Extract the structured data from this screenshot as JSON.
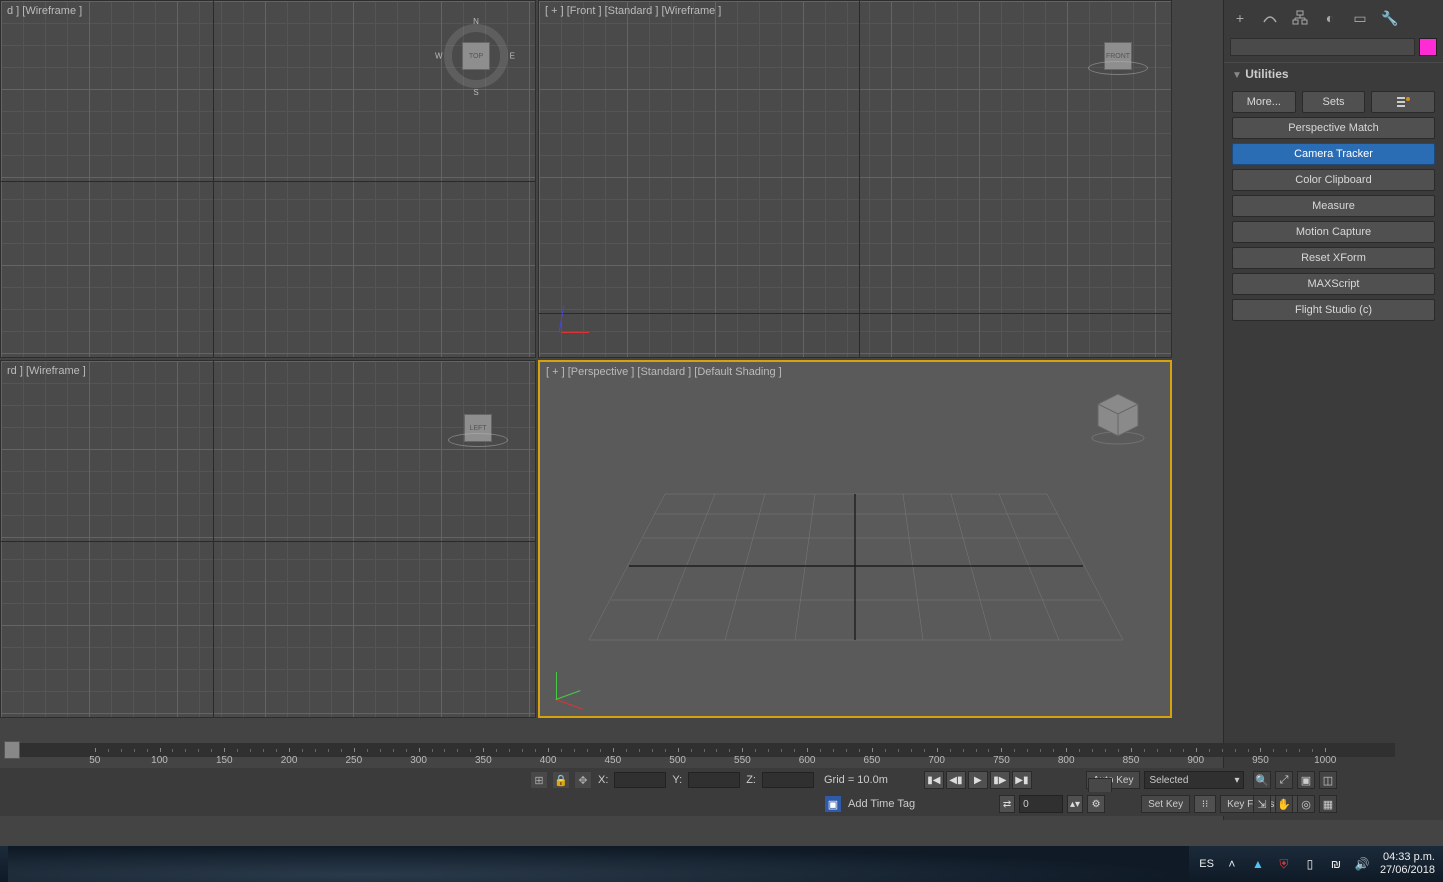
{
  "viewports": {
    "top_left": {
      "label": "d ] [Wireframe ]",
      "cube": "TOP",
      "compass": {
        "n": "N",
        "e": "E",
        "s": "S",
        "w": "W"
      }
    },
    "top_right": {
      "label": "[ + ] [Front ] [Standard ] [Wireframe ]",
      "cube": "FRONT"
    },
    "bottom_left": {
      "label": "rd ] [Wireframe ]",
      "cube": "LEFT"
    },
    "bottom_right": {
      "label": "[ + ] [Perspective ] [Standard ] [Default Shading ]"
    }
  },
  "side_panel": {
    "rollout_title": "Utilities",
    "more_label": "More...",
    "sets_label": "Sets",
    "buttons": {
      "persp_match": "Perspective Match",
      "camera_tracker": "Camera Tracker",
      "color_clipboard": "Color Clipboard",
      "measure": "Measure",
      "motion_capture": "Motion Capture",
      "reset_xform": "Reset XForm",
      "maxscript": "MAXScript",
      "flight_studio": "Flight Studio (c)"
    }
  },
  "timeline": {
    "tick_values": [
      "50",
      "100",
      "150",
      "200",
      "250",
      "300",
      "350",
      "400",
      "450",
      "500",
      "550",
      "600",
      "650",
      "700",
      "750",
      "800",
      "850",
      "900",
      "950",
      "1000"
    ]
  },
  "status": {
    "X": "X:",
    "Y": "Y:",
    "Z": "Z:",
    "grid_info": "Grid = 10.0m",
    "auto_key": "Auto Key",
    "set_key": "Set Key",
    "selected": "Selected",
    "key_filters": "Key Filters...",
    "spinner_value": "0",
    "add_time_tag": "Add Time Tag"
  },
  "taskbar": {
    "lang": "ES",
    "time": "04:33 p.m.",
    "date": "27/06/2018"
  }
}
